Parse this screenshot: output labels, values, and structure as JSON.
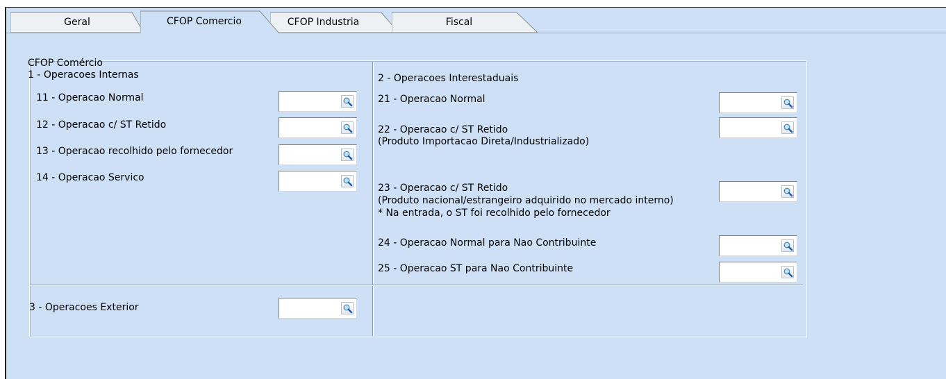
{
  "tabs": [
    {
      "label": "Geral"
    },
    {
      "label": "CFOP Comercio"
    },
    {
      "label": "CFOP Industria"
    },
    {
      "label": "Fiscal"
    }
  ],
  "panel": {
    "title": "CFOP Comércio",
    "internas": {
      "heading": "1 - Operacoes Internas",
      "items": [
        {
          "label": "11 - Operacao Normal",
          "value": ""
        },
        {
          "label": "12 - Operacao c/ ST Retido",
          "value": ""
        },
        {
          "label": "13 - Operacao recolhido pelo fornecedor",
          "value": ""
        },
        {
          "label": "14 - Operacao Servico",
          "value": ""
        }
      ]
    },
    "interestaduais": {
      "heading": "2 - Operacoes Interestaduais",
      "items": [
        {
          "label": "21 - Operacao Normal",
          "value": ""
        },
        {
          "label": "22 - Operacao c/ ST Retido",
          "note1": "(Produto Importacao Direta/Industrializado)",
          "value": ""
        },
        {
          "label": "23 - Operacao c/ ST Retido",
          "note1": "(Produto nacional/estrangeiro adquirido no mercado interno)",
          "note2": "* Na entrada, o ST foi recolhido pelo fornecedor",
          "value": ""
        },
        {
          "label": "24 - Operacao Normal para Nao Contribuinte",
          "value": ""
        },
        {
          "label": "25 - Operacao ST para Nao Contribuinte",
          "value": ""
        }
      ]
    },
    "exterior": {
      "heading": "3 - Operacoes Exterior",
      "value": ""
    }
  },
  "colors": {
    "background": "#cde0f6",
    "tab_active": "#cde0f6",
    "tab_inactive": "#eef1f4"
  },
  "icons": {
    "lookup": "magnifier-icon"
  }
}
